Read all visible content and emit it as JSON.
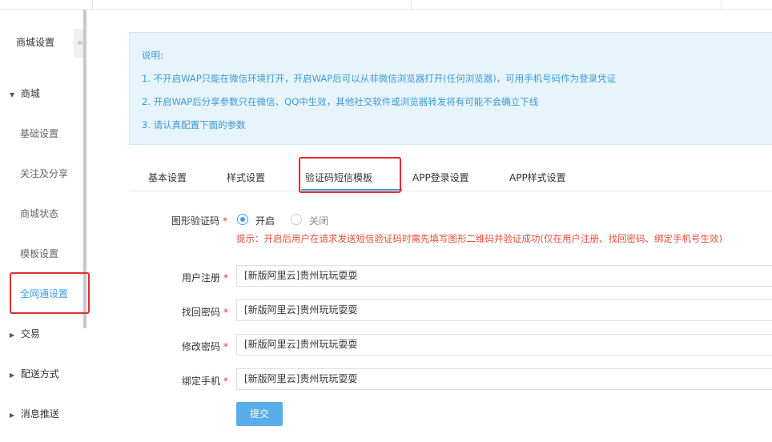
{
  "sidebar": {
    "title": "商城设置",
    "collapse_glyph": "«",
    "groups": [
      {
        "label": "商城",
        "caret": "▼"
      },
      {
        "label": "交易",
        "caret": "▶"
      },
      {
        "label": "配送方式",
        "caret": "▶"
      },
      {
        "label": "消息推送",
        "caret": "▶"
      }
    ],
    "items": [
      {
        "label": "基础设置"
      },
      {
        "label": "关注及分享"
      },
      {
        "label": "商城状态"
      },
      {
        "label": "模板设置"
      },
      {
        "label": "全网通设置"
      }
    ],
    "active_item": "全网通设置"
  },
  "info": {
    "lines": [
      "说明:",
      "1. 不开启WAP只能在微信环境打开，开启WAP后可以从非微信浏览器打开(任何浏览器)，可用手机号码作为登录凭证",
      "2. 开启WAP后分享参数只在微信、QQ中生效，其他社交软件或浏览器转发将有可能不会确立下线",
      "3. 请认真配置下面的参数"
    ]
  },
  "tabs": [
    {
      "label": "基本设置"
    },
    {
      "label": "样式设置"
    },
    {
      "label": "验证码短信模板"
    },
    {
      "label": "APP登录设置"
    },
    {
      "label": "APP样式设置"
    }
  ],
  "active_tab": "验证码短信模板",
  "form": {
    "captcha": {
      "label": "图形验证码",
      "required_mark": "*",
      "options": [
        "开启",
        "关闭"
      ],
      "selected": "开启",
      "hint": "提示：开启后用户在请求发送短信验证码时需先填写图形二维码并验证成功(仅在用户注册、找回密码、绑定手机号生效)"
    },
    "fields": [
      {
        "label": "用户注册",
        "required_mark": "*",
        "value": "[新版阿里云]贵州玩玩耍耍"
      },
      {
        "label": "找回密码",
        "required_mark": "*",
        "value": "[新版阿里云]贵州玩玩耍耍"
      },
      {
        "label": "修改密码",
        "required_mark": "*",
        "value": "[新版阿里云]贵州玩玩耍耍"
      },
      {
        "label": "绑定手机",
        "required_mark": "*",
        "value": "[新版阿里云]贵州玩玩耍耍"
      }
    ],
    "submit_label": "提交"
  },
  "colors": {
    "accent": "#3aa0e8",
    "highlight_box": "#e22d2d",
    "info_bg": "#e8f4fb",
    "hint_text": "#e74c3c"
  }
}
